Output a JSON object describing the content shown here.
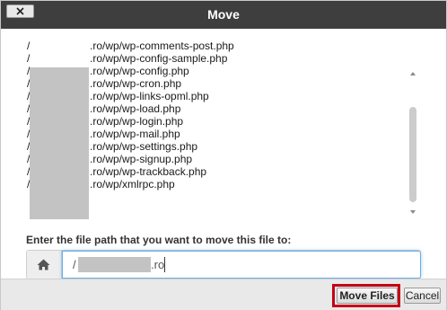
{
  "dialog": {
    "title": "Move",
    "close_label": "×"
  },
  "files": [
    {
      "prefix": "/",
      "path": ".ro/wp/wp-comments-post.php"
    },
    {
      "prefix": "/",
      "path": ".ro/wp/wp-config-sample.php"
    },
    {
      "prefix": "/",
      "path": ".ro/wp/wp-config.php"
    },
    {
      "prefix": "/",
      "path": ".ro/wp/wp-cron.php"
    },
    {
      "prefix": "/",
      "path": ".ro/wp/wp-links-opml.php"
    },
    {
      "prefix": "/",
      "path": ".ro/wp/wp-load.php"
    },
    {
      "prefix": "/",
      "path": ".ro/wp/wp-login.php"
    },
    {
      "prefix": "/",
      "path": ".ro/wp/wp-mail.php"
    },
    {
      "prefix": "/",
      "path": ".ro/wp/wp-settings.php"
    },
    {
      "prefix": "/",
      "path": ".ro/wp/wp-signup.php"
    },
    {
      "prefix": "/",
      "path": ".ro/wp/wp-trackback.php"
    },
    {
      "prefix": "/",
      "path": ".ro/wp/xmlrpc.php"
    }
  ],
  "destination": {
    "prompt": "Enter the file path that you want to move this file to:",
    "value_prefix": "/",
    "value_suffix": ".ro",
    "home_icon": "home-icon"
  },
  "footer": {
    "move_label": "Move Files",
    "cancel_label": "Cancel",
    "highlight_color": "#c40016"
  }
}
